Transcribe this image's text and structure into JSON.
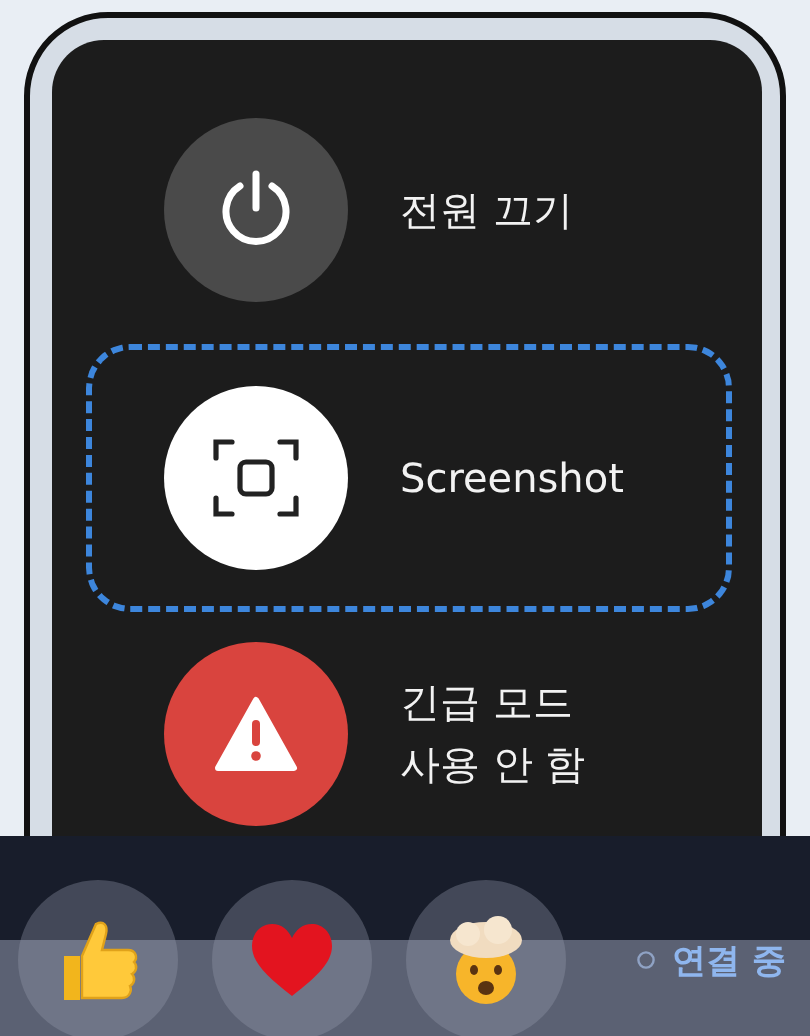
{
  "power_menu": {
    "actions": [
      {
        "kind": "power",
        "label": "전원 끄기",
        "selected": false
      },
      {
        "kind": "screenshot",
        "label": "Screenshot",
        "selected": true
      },
      {
        "kind": "emergency",
        "label": "긴급 모드",
        "sublabel": "사용 안 함",
        "selected": false
      }
    ]
  },
  "reaction_bar": {
    "reactions": [
      {
        "kind": "thumbs-up"
      },
      {
        "kind": "heart"
      },
      {
        "kind": "mind-blown"
      }
    ],
    "status": {
      "text": "연결 중"
    }
  }
}
